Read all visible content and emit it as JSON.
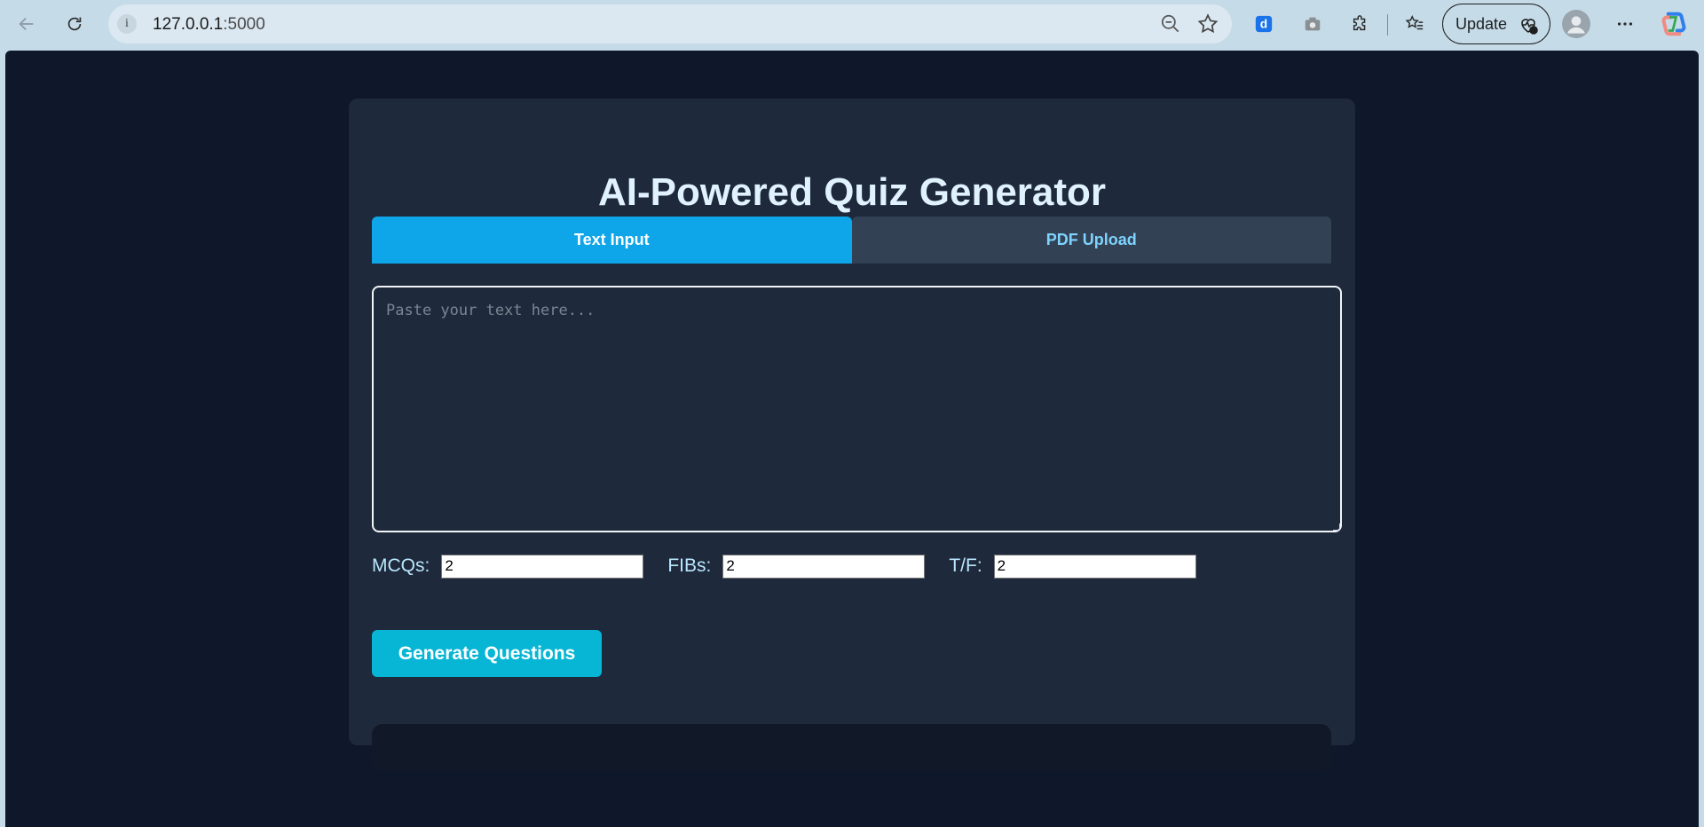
{
  "browser": {
    "url_host": "127.0.0.1",
    "url_port": ":5000",
    "update_label": "Update"
  },
  "page": {
    "title": "AI-Powered Quiz Generator",
    "tabs": [
      {
        "label": "Text Input",
        "active": true
      },
      {
        "label": "PDF Upload",
        "active": false
      }
    ],
    "textarea": {
      "placeholder": "Paste your text here...",
      "value": ""
    },
    "counts": {
      "mcq": {
        "label": "MCQs:",
        "value": "2"
      },
      "fib": {
        "label": "FIBs:",
        "value": "2"
      },
      "tf": {
        "label": "T/F:",
        "value": "2"
      }
    },
    "generate_label": "Generate Questions",
    "output_text": ""
  },
  "colors": {
    "page_bg": "#0f172a",
    "card_bg": "#1e293b",
    "tab_active": "#0ea5e9",
    "tab_inactive": "#334155",
    "button": "#06b6d4"
  }
}
